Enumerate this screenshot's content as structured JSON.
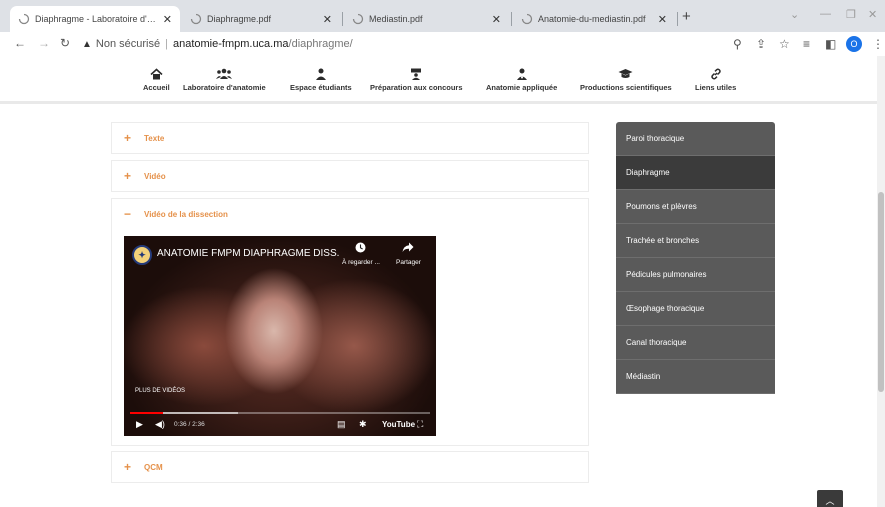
{
  "browser": {
    "tabs": [
      {
        "title": "Diaphragme - Laboratoire d'anat",
        "active": true
      },
      {
        "title": "Diaphragme.pdf",
        "active": false
      },
      {
        "title": "Mediastin.pdf",
        "active": false
      },
      {
        "title": "Anatomie-du-mediastin.pdf",
        "active": false
      }
    ],
    "new_tab": "+",
    "address": {
      "security": "Non sécurisé",
      "host": "anatomie-fmpm.uca.ma",
      "path": "/diaphragme/"
    },
    "profile_initial": "O"
  },
  "site_nav": [
    {
      "label": "Accueil",
      "icon": "home-icon"
    },
    {
      "label": "Laboratoire d'anatomie",
      "icon": "users-icon"
    },
    {
      "label": "Espace étudiants",
      "icon": "student-icon"
    },
    {
      "label": "Préparation aux concours",
      "icon": "teacher-icon"
    },
    {
      "label": "Anatomie appliquée",
      "icon": "doctor-icon"
    },
    {
      "label": "Productions scientifiques",
      "icon": "graduation-cap-icon"
    },
    {
      "label": "Liens utiles",
      "icon": "link-icon"
    }
  ],
  "accordion": [
    {
      "label": "Texte",
      "sign": "+"
    },
    {
      "label": "Vidéo",
      "sign": "+"
    },
    {
      "label": "Vidéo de la dissection",
      "sign": "−"
    },
    {
      "label": "QCM",
      "sign": "+"
    }
  ],
  "video": {
    "title": "ANATOMIE FMPM DIAPHRAGME DISS.",
    "watch_later": "À regarder ...",
    "share": "Partager",
    "more_videos": "PLUS DE VIDÉOS",
    "time": "0:36 / 2:36",
    "brand": "YouTube",
    "played_fraction": 0.11,
    "buffered_fraction": 0.36
  },
  "side_menu": {
    "items": [
      "Paroi thoracique",
      "Diaphragme",
      "Poumons et plèvres",
      "Trachée et bronches",
      "Pédicules pulmonaires",
      "Œsophage thoracique",
      "Canal thoracique",
      "Médiastin"
    ],
    "active_index": 1
  },
  "colors": {
    "accent": "#e5914a",
    "side_bg": "#5a5a5a",
    "side_active": "#3b3b3b"
  }
}
